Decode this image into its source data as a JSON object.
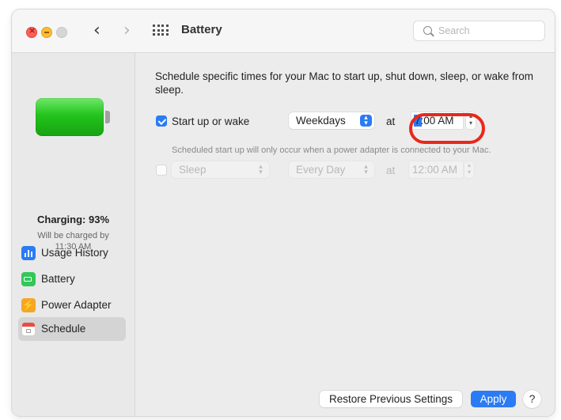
{
  "window": {
    "title": "Battery"
  },
  "search": {
    "placeholder": "Search"
  },
  "nav": {
    "back": "‹",
    "forward": "›"
  },
  "sidebar": {
    "battery_level_fraction": 0.93,
    "charging_title": "Charging: 93%",
    "charging_sub_line1": "Will be charged by",
    "charging_sub_line2": "11:30 AM",
    "items": [
      {
        "label": "Usage History",
        "icon": "usage-history-icon"
      },
      {
        "label": "Battery",
        "icon": "battery-icon"
      },
      {
        "label": "Power Adapter",
        "icon": "power-adapter-icon"
      },
      {
        "label": "Schedule",
        "icon": "schedule-icon",
        "selected": true
      }
    ]
  },
  "main": {
    "description": "Schedule specific times for your Mac to start up, shut down, sleep, or wake from sleep.",
    "schedule_1": {
      "checked": true,
      "label": "Start up or wake",
      "days": "Weekdays",
      "at": "at",
      "time": "7:00 AM",
      "note": "Scheduled start up will only occur when a power adapter is connected to your Mac."
    },
    "schedule_2": {
      "checked": false,
      "action": "Sleep",
      "days": "Every Day",
      "at": "at",
      "time": "12:00 AM"
    },
    "buttons": {
      "restore": "Restore Previous Settings",
      "apply": "Apply",
      "help": "?"
    }
  },
  "colors": {
    "accent": "#2a7bf4",
    "battery_green": "#23c41c",
    "annotation_red": "#e8281c"
  }
}
